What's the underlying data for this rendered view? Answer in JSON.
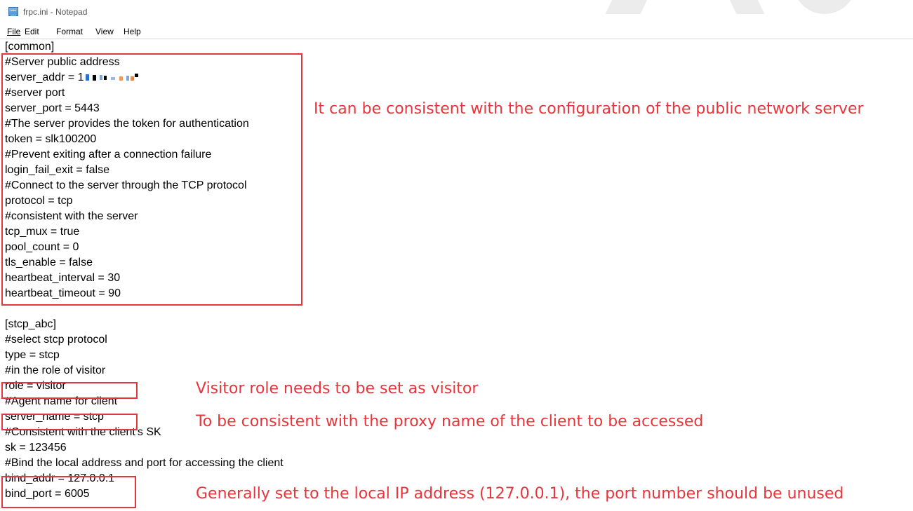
{
  "window": {
    "title": "frpc.ini - Notepad"
  },
  "menu": {
    "items": [
      {
        "accel": "F",
        "rest": "ile"
      },
      {
        "accel": "E",
        "rest": "dit"
      },
      {
        "accel": "",
        "pre": "F",
        "accel2": "o",
        "rest": "rmat"
      },
      {
        "accel": "V",
        "rest": "iew"
      },
      {
        "accel": "H",
        "rest": "elp"
      }
    ],
    "file": "File",
    "edit": "Edit",
    "format": "Format",
    "view": "View",
    "help": "Help"
  },
  "editor": {
    "lines": [
      "[common]",
      "#Server public address",
      "server_addr = 1",
      "#server port",
      "server_port = 5443",
      "#The server provides the token for authentication",
      "token = slk100200",
      "#Prevent exiting after a connection failure",
      "login_fail_exit = false",
      "#Connect to the server through the TCP protocol",
      "protocol = tcp",
      "#consistent with the server",
      "tcp_mux = true",
      "pool_count = 0",
      "tls_enable = false",
      "heartbeat_interval = 30",
      "heartbeat_timeout = 90",
      "",
      "[stcp_abc]",
      "#select stcp protocol",
      "type = stcp",
      "#in the role of visitor",
      "role = visitor",
      "#Agent name for client",
      "server_name = stcp",
      "#Consistent with the client's SK",
      "sk = 123456",
      "#Bind the local address and port for accessing the client",
      "bind_addr = 127.0.0.1",
      "bind_port = 6005"
    ]
  },
  "annotations": {
    "common_note": "It can be consistent with the configuration of the public network server",
    "role_note": "Visitor role needs to be set as visitor",
    "server_name_note": "To be consistent with the proxy name of the client to be accessed",
    "bind_note": "Generally set to the local IP address (127.0.0.1), the port number should be unused"
  },
  "colors": {
    "annotation_red": "#e8353b",
    "box_red": "#e0383e"
  }
}
